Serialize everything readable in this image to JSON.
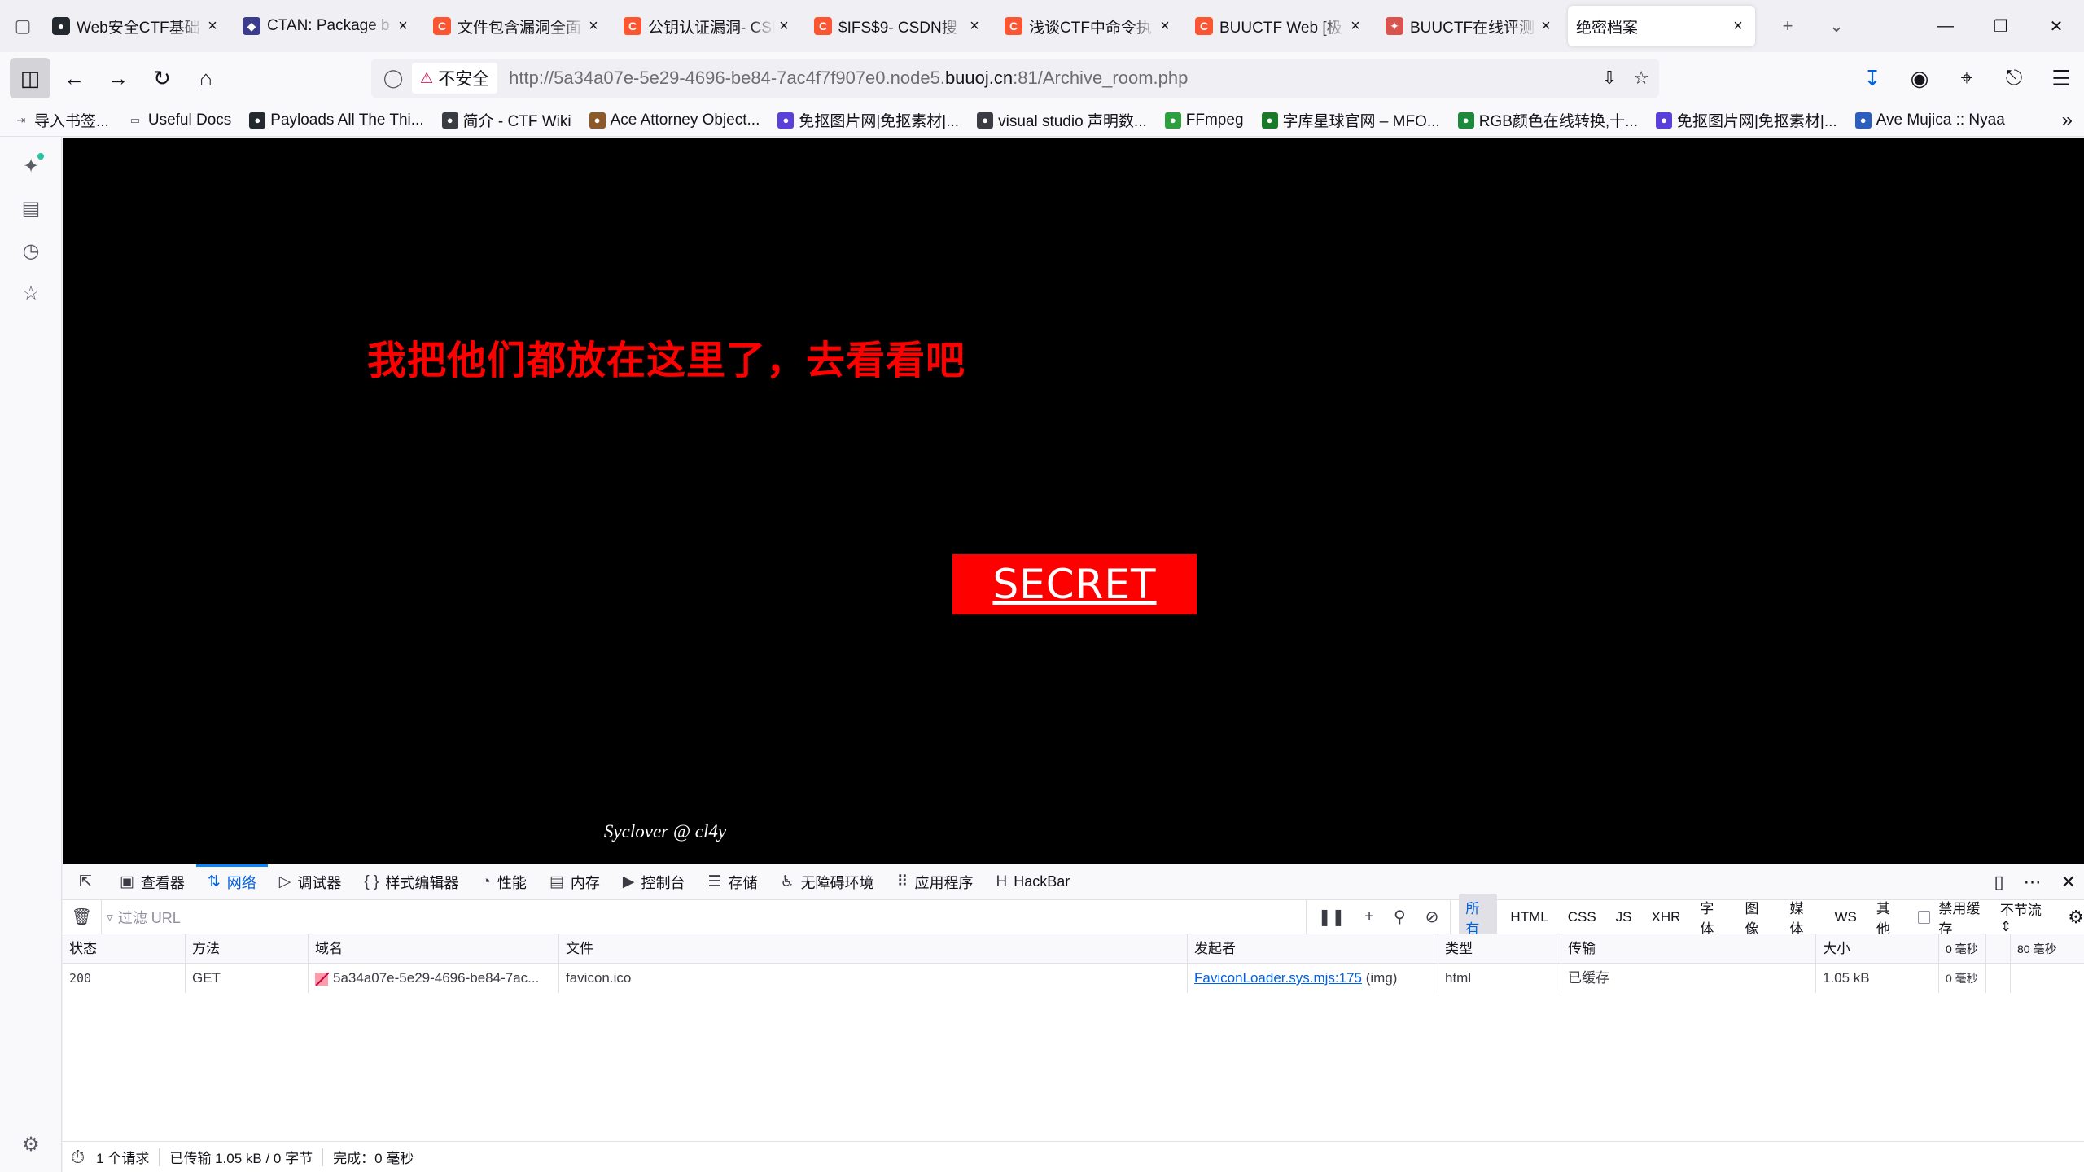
{
  "tabs": [
    {
      "title": "Web安全CTF基础",
      "icon": "github-icon",
      "color": "#24292f"
    },
    {
      "title": "CTAN: Package b",
      "icon": "ctan-icon",
      "color": "#3c3c8c"
    },
    {
      "title": "文件包含漏洞全面",
      "icon": "csdn-icon",
      "color": "#fc5531"
    },
    {
      "title": "公钥认证漏洞- CSI",
      "icon": "csdn-icon",
      "color": "#fc5531"
    },
    {
      "title": "$IFS$9- CSDN搜",
      "icon": "csdn-icon",
      "color": "#fc5531"
    },
    {
      "title": "浅谈CTF中命令执",
      "icon": "csdn-icon",
      "color": "#fc5531"
    },
    {
      "title": "BUUCTF Web [极",
      "icon": "csdn-icon",
      "color": "#fc5531"
    },
    {
      "title": "BUUCTF在线评测",
      "icon": "buuctf-icon",
      "color": "#d9534f"
    },
    {
      "title": "绝密档案",
      "icon": "",
      "color": "",
      "active": true
    }
  ],
  "nav": {
    "insecure_label": "不安全",
    "url_prefix": "http://5a34a07e-5e29-4696-be84-7ac4f7f907e0.node5.",
    "url_domain": "buuoj.cn",
    "url_suffix": ":81/Archive_room.php"
  },
  "bookmarks": [
    {
      "label": "导入书签...",
      "icon": "import-icon",
      "color": "#5b5b66"
    },
    {
      "label": "Useful Docs",
      "icon": "folder-icon",
      "color": "#5b5b66"
    },
    {
      "label": "Payloads All The Thi...",
      "icon": "github-icon",
      "color": "#24292f"
    },
    {
      "label": "简介 - CTF Wiki",
      "icon": "ctfwiki-icon",
      "color": "#3b3b44"
    },
    {
      "label": "Ace Attorney Object...",
      "icon": "ace-attorney-icon",
      "color": "#8a5a2b"
    },
    {
      "label": "免抠图片网|免抠素材|...",
      "icon": "pngtree-icon",
      "color": "#5b3fd9"
    },
    {
      "label": "visual studio 声明数...",
      "icon": "vs-icon",
      "color": "#3b3b44"
    },
    {
      "label": "FFmpeg",
      "icon": "ffmpeg-icon",
      "color": "#2e9e3e"
    },
    {
      "label": "字库星球官网 – MFO...",
      "icon": "mfont-icon",
      "color": "#1a7a2a"
    },
    {
      "label": "RGB颜色在线转换,十...",
      "icon": "rgb-icon",
      "color": "#1c8a3c"
    },
    {
      "label": "免抠图片网|免抠素材|...",
      "icon": "pngtree-icon",
      "color": "#5b3fd9"
    },
    {
      "label": "Ave Mujica :: Nyaa",
      "icon": "nyaa-icon",
      "color": "#2b5fbd"
    }
  ],
  "page": {
    "headline": "我把他们都放在这里了，去看看吧",
    "button": "SECRET",
    "footer": "Syclover @ cl4y",
    "bg_color": "#000000",
    "accent_color": "#ff0000"
  },
  "devtools": {
    "tabs": [
      {
        "label": "查看器",
        "icon": "inspector-icon"
      },
      {
        "label": "网络",
        "icon": "network-icon",
        "active": true
      },
      {
        "label": "调试器",
        "icon": "debugger-icon"
      },
      {
        "label": "样式编辑器",
        "icon": "style-editor-icon"
      },
      {
        "label": "性能",
        "icon": "performance-icon"
      },
      {
        "label": "内存",
        "icon": "memory-icon"
      },
      {
        "label": "控制台",
        "icon": "console-icon"
      },
      {
        "label": "存储",
        "icon": "storage-icon"
      },
      {
        "label": "无障碍环境",
        "icon": "accessibility-icon"
      },
      {
        "label": "应用程序",
        "icon": "application-icon"
      },
      {
        "label": "HackBar",
        "icon": "hackbar-icon"
      }
    ],
    "filter_placeholder": "过滤 URL",
    "filter_types": [
      "所有",
      "HTML",
      "CSS",
      "JS",
      "XHR",
      "字体",
      "图像",
      "媒体",
      "WS",
      "其他"
    ],
    "disable_cache": "禁用缓存",
    "throttle": "不节流",
    "columns": {
      "status": "状态",
      "method": "方法",
      "domain": "域名",
      "file": "文件",
      "initiator": "发起者",
      "type": "类型",
      "transferred": "传输",
      "size": "大小",
      "t0": "0 毫秒",
      "t2": "80 毫秒"
    },
    "rows": [
      {
        "status": "200",
        "method": "GET",
        "domain": "5a34a07e-5e29-4696-be84-7ac...",
        "file": "favicon.ico",
        "initiator_link": "FaviconLoader.sys.mjs:175",
        "initiator_extra": " (img)",
        "type": "html",
        "transferred": "已缓存",
        "size": "1.05 kB",
        "timing": "0 毫秒"
      }
    ],
    "status": {
      "requests": "1 个请求",
      "transferred": "已传输 1.05 kB / 0 字节",
      "finish": "完成：0 毫秒"
    }
  }
}
